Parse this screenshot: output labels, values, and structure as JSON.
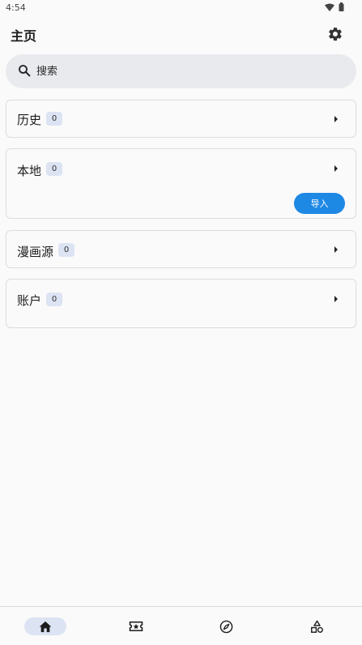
{
  "status_bar": {
    "time": "4:54"
  },
  "header": {
    "title": "主页"
  },
  "search": {
    "placeholder": "搜索"
  },
  "cards": [
    {
      "title": "历史",
      "count": "0"
    },
    {
      "title": "本地",
      "count": "0",
      "action_label": "导入"
    },
    {
      "title": "漫画源",
      "count": "0"
    },
    {
      "title": "账户",
      "count": "0"
    }
  ],
  "colors": {
    "accent": "#1e88e5",
    "badge_bg": "#dce3f3",
    "background": "#fafafa"
  },
  "bottom_nav": {
    "items": [
      {
        "icon": "home-icon",
        "active": true
      },
      {
        "icon": "ticket-star-icon",
        "active": false
      },
      {
        "icon": "compass-icon",
        "active": false
      },
      {
        "icon": "shapes-icon",
        "active": false
      }
    ]
  }
}
